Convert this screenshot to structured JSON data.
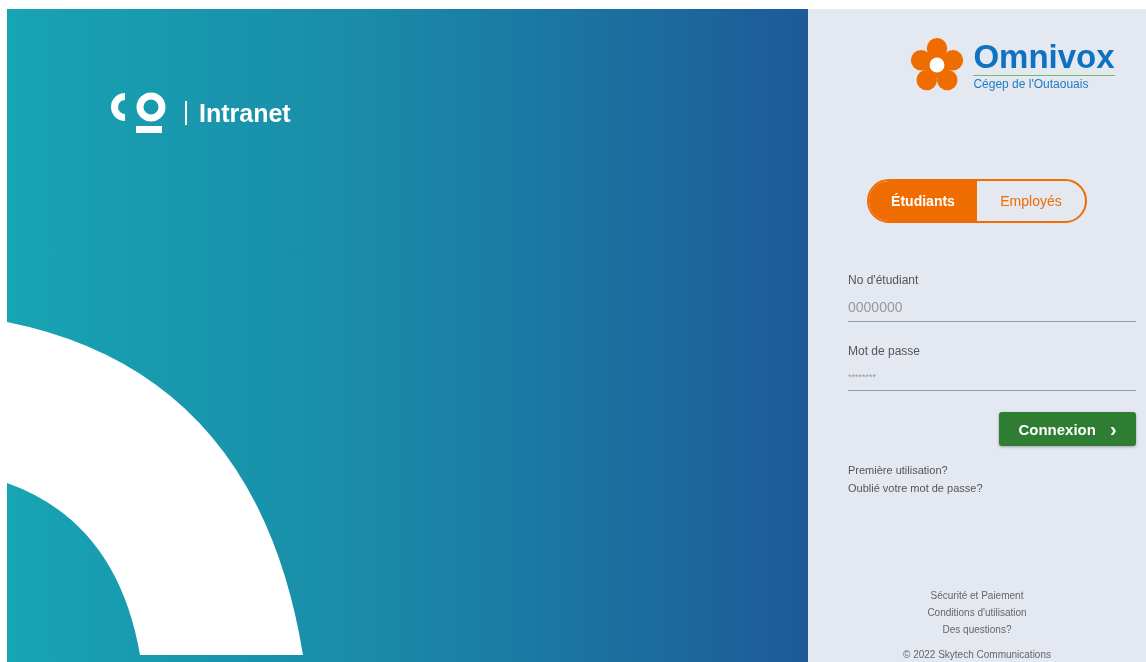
{
  "intranet": {
    "title": "Intranet"
  },
  "brand": {
    "name": "Omnivox",
    "subtitle": "Cégep de l'Outaouais"
  },
  "tabs": [
    {
      "label": "Étudiants",
      "selected": true
    },
    {
      "label": "Employés",
      "selected": false
    }
  ],
  "fields": [
    {
      "label": "No d'étudiant",
      "placeholder": "0000000",
      "kind": "text"
    },
    {
      "label": "Mot de passe",
      "placeholder": "********",
      "kind": "password"
    }
  ],
  "submit": {
    "label": "Connexion",
    "icon": "›"
  },
  "help_links": [
    "Première utilisation?",
    "Oublié votre mot de passe?"
  ],
  "footer_links": [
    "Sécurité et Paiement",
    "Conditions d'utilisation",
    "Des questions?"
  ],
  "copyright": "© 2022 Skytech Communications"
}
